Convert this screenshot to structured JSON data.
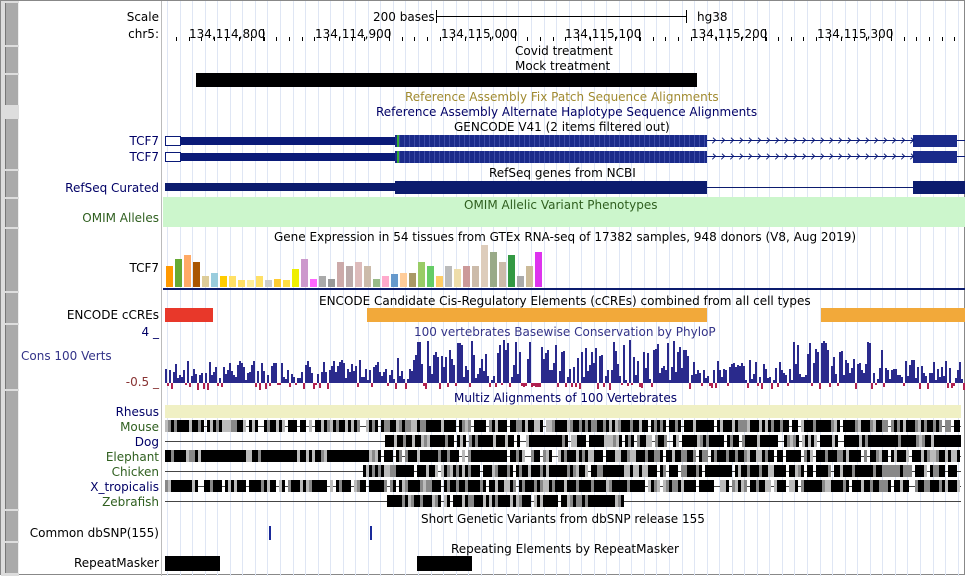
{
  "labels": {
    "scale": "Scale",
    "chrom": "chr5:",
    "tcf7_a": "TCF7",
    "tcf7_b": "TCF7",
    "refseq": "RefSeq Curated",
    "omim": "OMIM Alleles",
    "gtex": "TCF7",
    "encode": "ENCODE cCREs",
    "cons_max": "4 _",
    "cons": "Cons 100 Verts",
    "cons_min": "-0.5 _",
    "species": [
      "Rhesus",
      "Mouse",
      "Dog",
      "Elephant",
      "Chicken",
      "X_tropicalis",
      "Zebrafish"
    ],
    "dbsnp": "Common dbSNP(155)",
    "rmsk": "RepeatMasker"
  },
  "ruler": {
    "scale_text": "200 bases",
    "assembly": "hg38",
    "positions": [
      "134,114,800",
      "134,114,900",
      "134,115,000",
      "134,115,100",
      "134,115,200",
      "134,115,300"
    ]
  },
  "track_titles": {
    "covid": "Covid treatment",
    "mock": "Mock treatment",
    "fix_patch": "Reference Assembly Fix Patch Sequence Alignments",
    "alt_hap": "Reference Assembly Alternate Haplotype Sequence Alignments",
    "gencode": "GENCODE V41 (2 items filtered out)",
    "refseq": "RefSeq genes from NCBI",
    "omim": "OMIM Allelic Variant Phenotypes",
    "gtex": "Gene Expression in 54 tissues from GTEx RNA-seq of 17382 samples, 948 donors (V8, Aug 2019)",
    "encode": "ENCODE Candidate Cis-Regulatory Elements (cCREs) combined from all cell types",
    "phylop": "100 vertebrates Basewise Conservation by PhyloP",
    "multiz": "Multiz Alignments of 100 Vertebrates",
    "dbsnp": "Short Genetic Variants from dbSNP release 155",
    "rmsk": "Repeating Elements by RepeatMasker"
  },
  "colors": {
    "gene_navy": "#0a1a78",
    "refseq_navy": "#0c1c6e",
    "omim_bg": "#ccf6cc",
    "omim_text": "#2f5f1f",
    "encode_red": "#e8382a",
    "encode_orange": "#f2a93a",
    "phylop_blue": "#2a2a8c",
    "phylop_red": "#b02050",
    "rhesus_bar": "#f0f0c4",
    "fix_patch_text": "#a08a30",
    "alt_hap_text": "#000066"
  },
  "gtex_bar_colors": [
    "#ff9900",
    "#66aa33",
    "#ffaa66",
    "#aa5500",
    "#ddcc99",
    "#99ccdd",
    "#ffcc00",
    "#ffe066",
    "#ffe066",
    "#ffee99",
    "#ffe066",
    "#cccccc",
    "#ffcc33",
    "#ffdd44",
    "#eeee00",
    "#cc99cc",
    "#ff66ff",
    "#aaaaaa",
    "#999999",
    "#ccaaaa",
    "#bbaaaa",
    "#ddbbbb",
    "#ccbbaa",
    "#99bb88",
    "#ffaacc",
    "#6699cc",
    "#ffcc99",
    "#aa9966",
    "#99cc66",
    "#66cc66",
    "#ffcc66",
    "#bbbbbb",
    "#eeddaa",
    "#cc9999",
    "#ccbbaa",
    "#ddccbb",
    "#99aa88",
    "#ccbbaa",
    "#339944",
    "#aaaaaa",
    "#ccbb99",
    "#dd33ee"
  ],
  "gtex_values": [
    0.3,
    0.4,
    0.45,
    0.35,
    0.15,
    0.2,
    0.15,
    0.15,
    0.1,
    0.1,
    0.15,
    0.1,
    0.12,
    0.1,
    0.25,
    0.4,
    0.12,
    0.15,
    0.12,
    0.35,
    0.3,
    0.35,
    0.3,
    0.12,
    0.15,
    0.18,
    0.2,
    0.2,
    0.35,
    0.3,
    0.15,
    0.3,
    0.25,
    0.3,
    0.3,
    0.6,
    0.5,
    0.35,
    0.45,
    0.15,
    0.3,
    0.5
  ]
}
